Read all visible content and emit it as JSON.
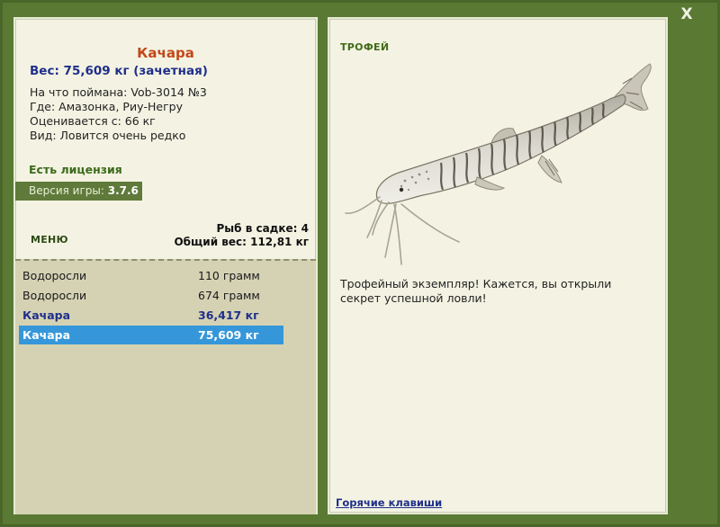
{
  "close_label": "X",
  "fish": {
    "name": "Качара",
    "weight_line": "Вес: 75,609 кг (зачетная)",
    "bait_line": "На что поймана: Vob-3014 №3",
    "location_line": "Где: Амазонка, Риу-Негру",
    "value_line": "Оценивается с: 66 кг",
    "rarity_line": "Вид: Ловится очень редко"
  },
  "license_text": "Есть лицензия",
  "version": {
    "label": "Версия игры: ",
    "value": "3.7.6"
  },
  "menu_label": "МЕНЮ",
  "keepnet": {
    "count_text": "Рыб в садке: 4",
    "total_text": "Общий вес: 112,81 кг"
  },
  "catch_list": [
    {
      "name": "Водоросли",
      "amount": "110 грамм",
      "style": "normal"
    },
    {
      "name": "Водоросли",
      "amount": "674 грамм",
      "style": "normal"
    },
    {
      "name": "Качара",
      "amount": "36,417 кг",
      "style": "trophy"
    },
    {
      "name": "Качара",
      "amount": "75,609 кг",
      "style": "selected"
    }
  ],
  "trophy_label": "ТРОФЕЙ",
  "description": "Трофейный экземпляр! Кажется, вы открыли секрет успешной ловли!",
  "hotkeys_link": "Горячие клавиши",
  "colors": {
    "frame": "#5a7a34",
    "panel": "#f4f3e3",
    "list_bg": "#d5d2b4",
    "selected_row": "#3597d9",
    "fish_name": "#c2491a",
    "trophy_text": "#1f2f8a",
    "license_text": "#3d6b1b"
  }
}
